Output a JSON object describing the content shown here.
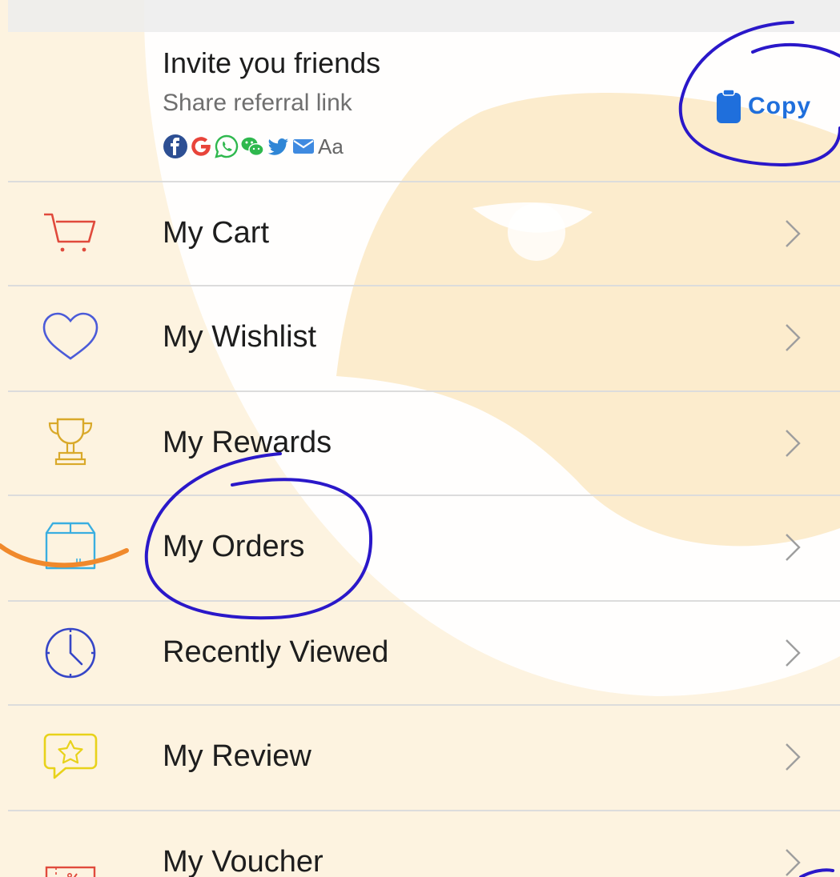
{
  "invite": {
    "title": "Invite you friends",
    "subtitle": "Share referral link",
    "share_icons": [
      "facebook-icon",
      "google-icon",
      "whatsapp-icon",
      "wechat-icon",
      "twitter-icon",
      "email-icon"
    ],
    "text_share_label": "Aa",
    "copy_label": "Copy"
  },
  "menu": [
    {
      "label": "My Cart",
      "icon": "cart-icon"
    },
    {
      "label": "My Wishlist",
      "icon": "heart-icon"
    },
    {
      "label": "My Rewards",
      "icon": "trophy-icon"
    },
    {
      "label": "My Orders",
      "icon": "box-icon"
    },
    {
      "label": "Recently Viewed",
      "icon": "clock-icon"
    },
    {
      "label": "My Review",
      "icon": "review-star-icon"
    },
    {
      "label": "My Voucher",
      "icon": "voucher-icon"
    }
  ],
  "colors": {
    "background_tint": "#fdf3e0",
    "copy_blue": "#1f6fdc",
    "annotation_blue": "#2a18c9",
    "annotation_orange": "#f0892c"
  }
}
